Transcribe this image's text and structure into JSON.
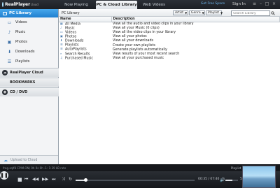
{
  "app": {
    "logo_text": "RealPlayer",
    "logo_version": "cloud"
  },
  "tabs": [
    {
      "label": "Now Playing"
    },
    {
      "label": "PC & Cloud Library"
    },
    {
      "label": "Web Videos"
    }
  ],
  "header": {
    "free_space": "Get Free Space",
    "sign_in": "Sign In"
  },
  "sidebar": {
    "header": "PC Library",
    "items": [
      {
        "label": "Videos",
        "icon": "video-icon"
      },
      {
        "label": "Music",
        "icon": "music-icon"
      },
      {
        "label": "Photos",
        "icon": "photo-icon"
      },
      {
        "label": "Downloads",
        "icon": "download-icon"
      },
      {
        "label": "Playlists",
        "icon": "playlist-icon"
      }
    ],
    "sections": [
      {
        "label": "RealPlayer Cloud"
      },
      {
        "label": "BOOKMARKS"
      },
      {
        "label": "CD / DVD"
      }
    ],
    "upload": "Upload to Cloud"
  },
  "main": {
    "title": "PC Library",
    "filters": {
      "artist": "Artist",
      "genre": "Genre",
      "playlist": "Playlist"
    },
    "search": {
      "placeholder": "Search Library"
    },
    "columns": {
      "name": "Name",
      "description": "Description"
    },
    "rows": [
      {
        "name": "All Media",
        "description": "View all the audio and video clips in your library",
        "icon": "library-icon"
      },
      {
        "name": "Music",
        "description": "View all your Music (0 clips)",
        "icon": "music-icon"
      },
      {
        "name": "Videos",
        "description": "View all the video clips in your library",
        "icon": "video-icon"
      },
      {
        "name": "Photos",
        "description": "View all your photos",
        "icon": "photo-icon"
      },
      {
        "name": "Downloads",
        "description": "View all your downloads",
        "icon": "download-icon"
      },
      {
        "name": "Playlists",
        "description": "Create your own playlists",
        "icon": "playlist-icon"
      },
      {
        "name": "AutoPlaylists",
        "description": "Generate playlists automatically",
        "icon": "autoplaylist-icon"
      },
      {
        "name": "Search Results",
        "description": "View results of your most recent search",
        "icon": "search-icon"
      },
      {
        "name": "Purchased Music",
        "description": "View all your purchased music",
        "icon": "purchased-icon"
      }
    ]
  },
  "status": {
    "text": "frag.sqlf8 CPIM.ON) 0h 0s 0h -1: 1:39 kB rate",
    "playlist": "Playlist"
  },
  "player": {
    "time": "00:35 / 07:40",
    "seek_fraction": 0.08,
    "volume_percent": "58%",
    "volume_fraction": 0.58
  },
  "colors": {
    "accent": "#2b8ee0",
    "dark_bg": "#1a1d22"
  }
}
